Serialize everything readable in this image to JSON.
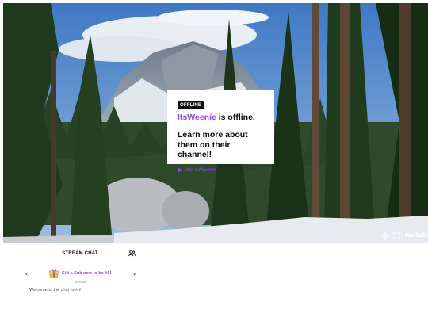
{
  "player": {
    "badge": "OFFLINE",
    "channel_name": "ItsWeenie",
    "offline_suffix": " is offline.",
    "learn_more": "Learn more about them on their channel!",
    "visit_link": "Visit ItsWeenie",
    "controls": {
      "settings_icon": "gear-icon",
      "fullscreen_icon": "fullscreen-icon",
      "logo": "twitch"
    }
  },
  "chat": {
    "title": "STREAM CHAT",
    "users_icon": "users-icon",
    "promo_text": "Gift a Sub now to be #1!",
    "promo_icon": "gift-icon",
    "welcome": "Welcome to the chat room!"
  },
  "colors": {
    "accent": "#9147ff",
    "text": "#0e0e10",
    "badge_bg": "#0e0e10"
  }
}
